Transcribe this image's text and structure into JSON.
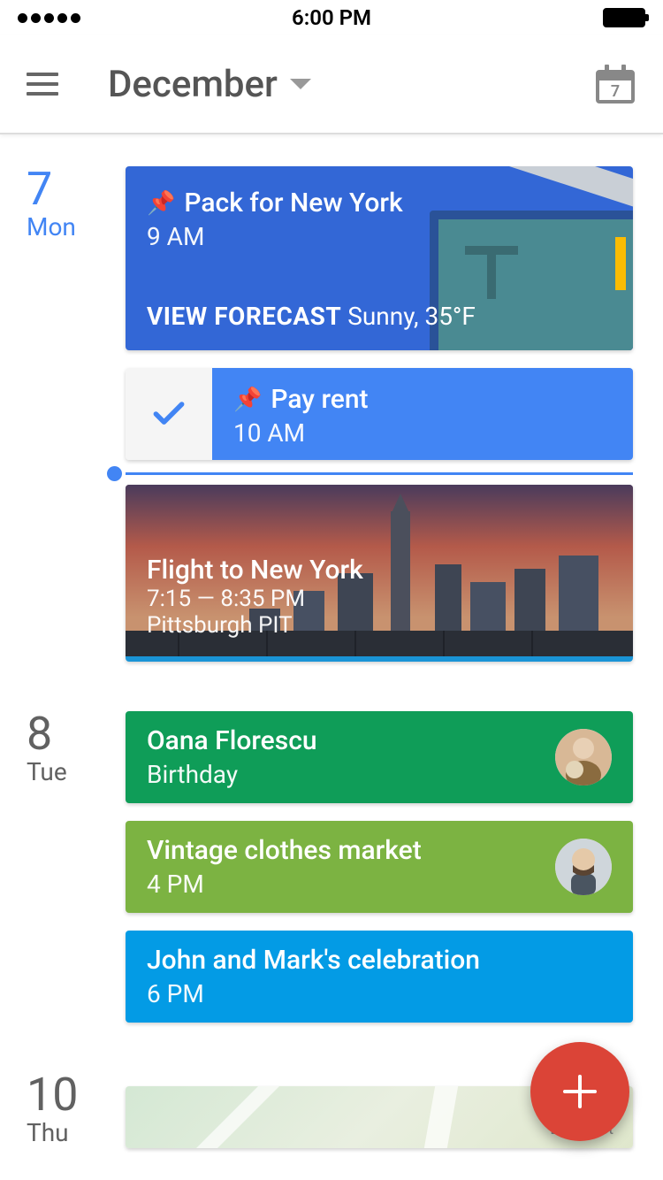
{
  "status_bar": {
    "time": "6:00 PM"
  },
  "header": {
    "month": "December",
    "today_date": "7"
  },
  "days": [
    {
      "number": "7",
      "name": "Mon",
      "is_today": true,
      "events": {
        "pack": {
          "title": "Pack for New York",
          "time": "9 AM",
          "forecast_label": "VIEW FORECAST",
          "forecast_text": "Sunny, 35°F"
        },
        "rent": {
          "title": "Pay rent",
          "time": "10 AM"
        },
        "flight": {
          "title": "Flight to New York",
          "time": "7:15 — 8:35 PM",
          "airport": "Pittsburgh PIT"
        }
      }
    },
    {
      "number": "8",
      "name": "Tue",
      "events": {
        "birthday": {
          "title": "Oana Florescu",
          "subtitle": "Birthday"
        },
        "market": {
          "title": "Vintage clothes market",
          "time": "4 PM"
        },
        "celebration": {
          "title": "John and Mark's celebration",
          "time": "6 PM"
        }
      }
    },
    {
      "number": "10",
      "name": "Thu",
      "map_label": "E 90th St"
    }
  ]
}
